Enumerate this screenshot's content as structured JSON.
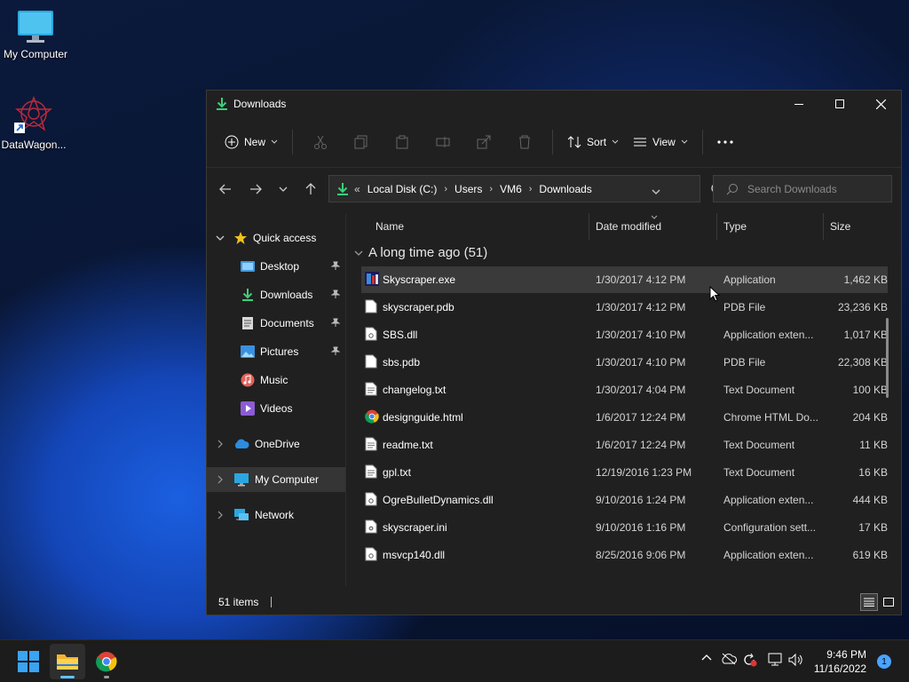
{
  "desktop": {
    "icons": [
      {
        "label": "My Computer"
      },
      {
        "label": "DataWagon..."
      }
    ]
  },
  "window": {
    "title": "Downloads",
    "toolbar": {
      "new_label": "New",
      "sort_label": "Sort",
      "view_label": "View"
    },
    "address": {
      "crumbs": [
        "Local Disk (C:)",
        "Users",
        "VM6",
        "Downloads"
      ],
      "overflow": "«"
    },
    "search": {
      "placeholder": "Search Downloads"
    },
    "nav": {
      "quick_access": "Quick access",
      "items": [
        {
          "label": "Desktop",
          "pinned": true
        },
        {
          "label": "Downloads",
          "pinned": true
        },
        {
          "label": "Documents",
          "pinned": true
        },
        {
          "label": "Pictures",
          "pinned": true
        },
        {
          "label": "Music"
        },
        {
          "label": "Videos"
        }
      ],
      "onedrive": "OneDrive",
      "mycomputer": "My Computer",
      "network": "Network"
    },
    "columns": {
      "name": "Name",
      "date": "Date modified",
      "type": "Type",
      "size": "Size"
    },
    "group": "A long time ago (51)",
    "files": [
      {
        "name": "Skyscraper.exe",
        "date": "1/30/2017 4:12 PM",
        "type": "Application",
        "size": "1,462 KB",
        "icon": "app-icon"
      },
      {
        "name": "skyscraper.pdb",
        "date": "1/30/2017 4:12 PM",
        "type": "PDB File",
        "size": "23,236 KB",
        "icon": "file-icon"
      },
      {
        "name": "SBS.dll",
        "date": "1/30/2017 4:10 PM",
        "type": "Application exten...",
        "size": "1,017 KB",
        "icon": "dll-icon"
      },
      {
        "name": "sbs.pdb",
        "date": "1/30/2017 4:10 PM",
        "type": "PDB File",
        "size": "22,308 KB",
        "icon": "file-icon"
      },
      {
        "name": "changelog.txt",
        "date": "1/30/2017 4:04 PM",
        "type": "Text Document",
        "size": "100 KB",
        "icon": "text-file-icon"
      },
      {
        "name": "designguide.html",
        "date": "1/6/2017 12:24 PM",
        "type": "Chrome HTML Do...",
        "size": "204 KB",
        "icon": "chrome-icon"
      },
      {
        "name": "readme.txt",
        "date": "1/6/2017 12:24 PM",
        "type": "Text Document",
        "size": "11 KB",
        "icon": "text-file-icon"
      },
      {
        "name": "gpl.txt",
        "date": "12/19/2016 1:23 PM",
        "type": "Text Document",
        "size": "16 KB",
        "icon": "text-file-icon"
      },
      {
        "name": "OgreBulletDynamics.dll",
        "date": "9/10/2016 1:24 PM",
        "type": "Application exten...",
        "size": "444 KB",
        "icon": "dll-icon"
      },
      {
        "name": "skyscraper.ini",
        "date": "9/10/2016 1:16 PM",
        "type": "Configuration sett...",
        "size": "17 KB",
        "icon": "config-file-icon"
      },
      {
        "name": "msvcp140.dll",
        "date": "8/25/2016 9:06 PM",
        "type": "Application exten...",
        "size": "619 KB",
        "icon": "dll-icon"
      }
    ],
    "status": {
      "items": "51 items"
    }
  },
  "taskbar": {
    "time": "9:46 PM",
    "date": "11/16/2022",
    "notifications": "1"
  }
}
